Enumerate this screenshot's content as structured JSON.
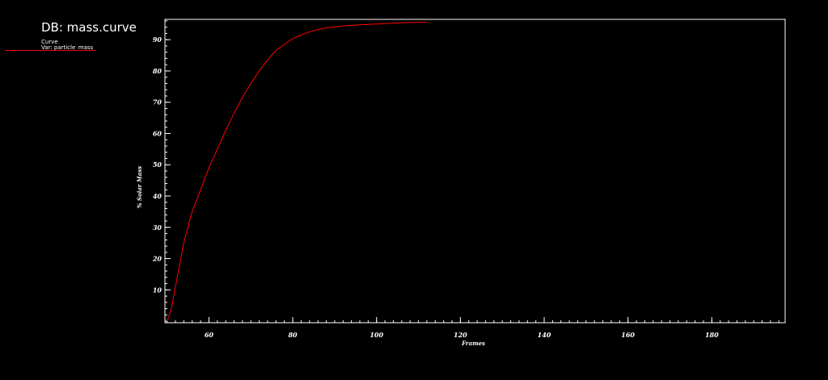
{
  "legend": {
    "db_title": "DB: mass.curve",
    "curve_label": "Curve",
    "var_label": "Var: particle_mass"
  },
  "colors": {
    "background": "#000000",
    "axes": "#ffffff",
    "curve": "#ff0000"
  },
  "chart_data": {
    "type": "line",
    "xlabel": "Frames",
    "ylabel": "% Solar Mass",
    "xlim": [
      49.5,
      197.5
    ],
    "ylim": [
      -0.5,
      96.5
    ],
    "xticks": [
      60,
      80,
      100,
      120,
      140,
      160,
      180
    ],
    "yticks": [
      10,
      20,
      30,
      40,
      50,
      60,
      70,
      80,
      90
    ],
    "grid": false,
    "legend_position": "top-left",
    "series": [
      {
        "name": "particle_mass",
        "x": [
          50,
          51,
          52,
          53,
          54,
          55,
          56,
          58,
          60,
          62,
          64,
          66,
          68,
          70,
          72,
          74,
          76,
          78,
          80,
          82,
          84,
          86,
          88,
          90,
          92,
          94,
          96,
          98,
          100,
          104,
          108,
          112
        ],
        "y": [
          0,
          4,
          11,
          18,
          25,
          30,
          35,
          42,
          49,
          55,
          61,
          66.5,
          71.5,
          76,
          80,
          83.5,
          86.5,
          88.5,
          90.3,
          91.5,
          92.5,
          93.2,
          93.8,
          94.1,
          94.4,
          94.6,
          94.8,
          94.9,
          95,
          95.3,
          95.5,
          95.6
        ]
      }
    ]
  }
}
